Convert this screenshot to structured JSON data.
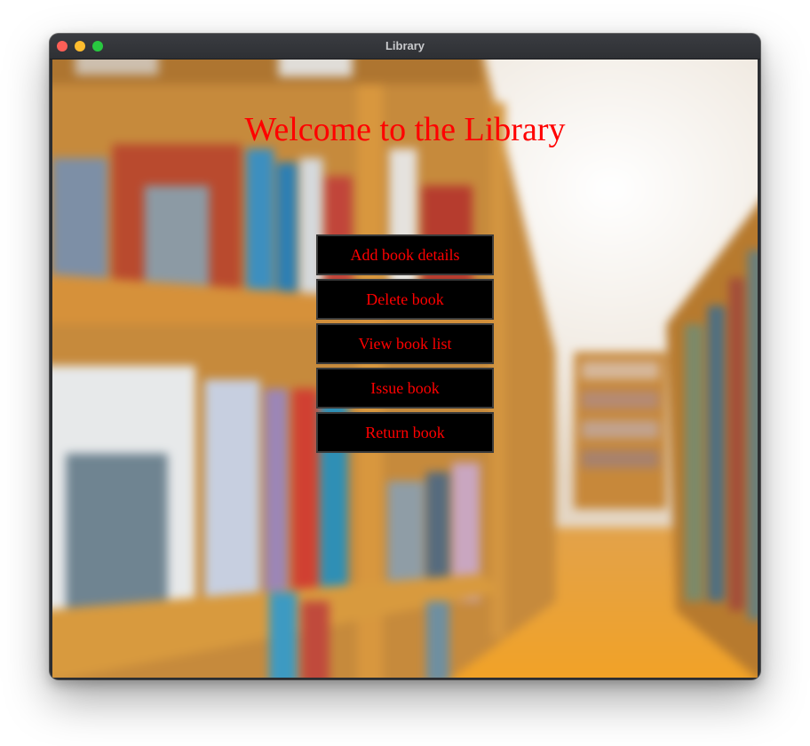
{
  "window": {
    "title": "Library",
    "controls": [
      "close",
      "minimize",
      "maximize"
    ]
  },
  "background": {
    "image": "blurred library bookshelves corridor"
  },
  "heading": "Welcome to the Library",
  "menu": [
    {
      "label": "Add book details"
    },
    {
      "label": "Delete book"
    },
    {
      "label": "View book list"
    },
    {
      "label": "Issue book"
    },
    {
      "label": "Return book"
    }
  ],
  "colors": {
    "heading_text": "#ff0000",
    "button_text": "#ff0000",
    "button_bg": "#000000",
    "titlebar": "#2e3034",
    "close": "#fe5f57",
    "minimize": "#febc2e",
    "maximize": "#28c840"
  }
}
